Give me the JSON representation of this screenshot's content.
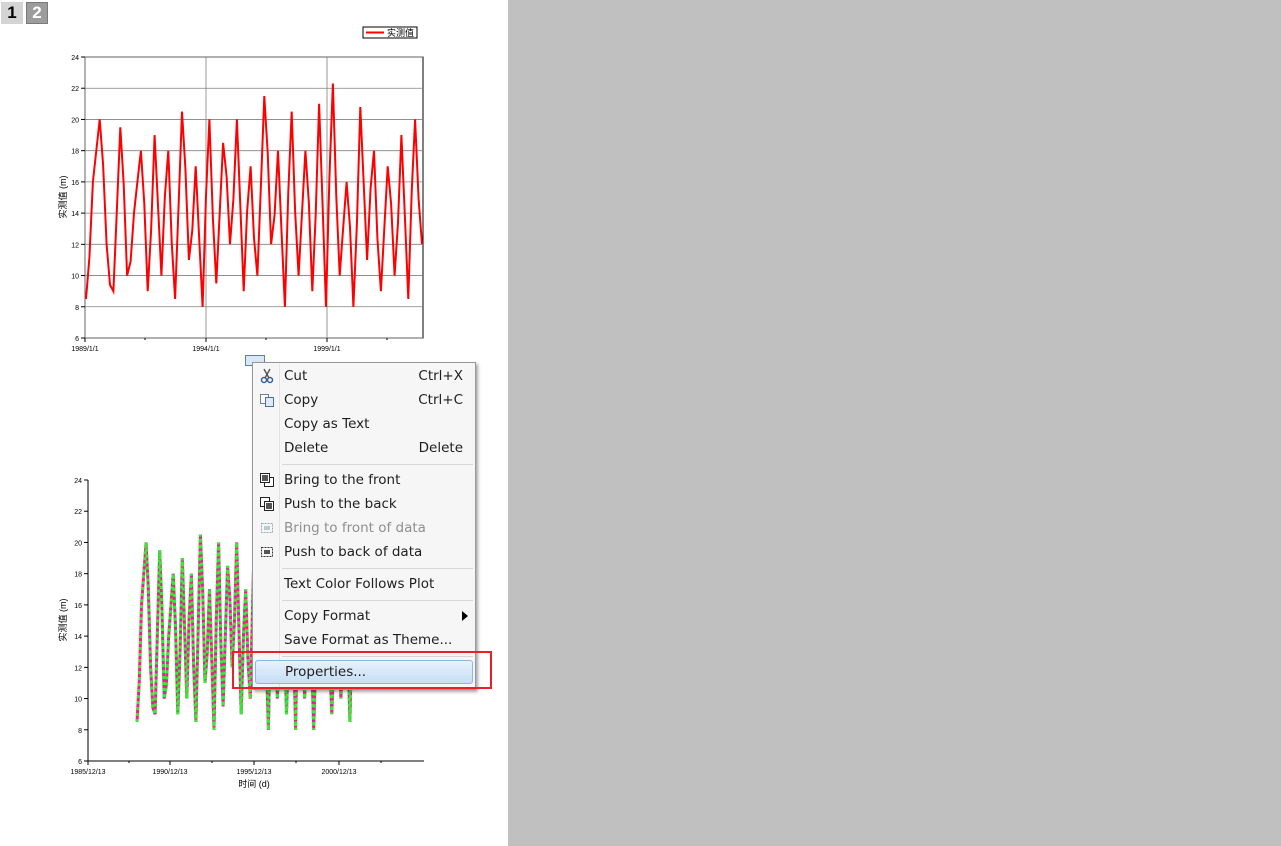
{
  "tabs": [
    {
      "label": "1"
    },
    {
      "label": "2"
    }
  ],
  "colors": {
    "series_red": "#ff0000",
    "series_magenta": "#e8208c",
    "series_green": "#30ee30",
    "highlight_box": "#e8202a",
    "background_gray": "#c0c0c0"
  },
  "chart_data": [
    {
      "type": "line",
      "legend": [
        "实测值"
      ],
      "legend_position": "top-right",
      "ylabel": "实测值 (m)",
      "xlabel": "",
      "x_ticks": [
        "1989/1/1",
        "1994/1/1",
        "1999/1/1"
      ],
      "y_ticks": [
        "6",
        "8",
        "10",
        "12",
        "14",
        "16",
        "18",
        "20",
        "22",
        "24"
      ],
      "ylim": [
        6,
        24
      ],
      "grid": true,
      "series": [
        {
          "values": [
            8.5,
            16,
            20,
            12,
            9,
            19.5,
            10,
            14,
            18,
            9,
            19,
            10,
            18,
            8.5,
            20.5,
            11,
            17,
            8,
            20,
            9.5,
            18.5,
            12,
            20,
            9,
            17,
            10,
            21.5,
            12,
            18,
            8,
            20.5,
            10,
            18,
            9,
            21,
            8,
            22.3,
            10,
            16,
            8,
            20.8,
            11,
            18,
            9,
            17,
            10,
            19,
            8.5,
            20,
            12
          ]
        }
      ]
    },
    {
      "type": "line",
      "ylabel": "实测值 (m)",
      "xlabel": "时间 (d)",
      "x_ticks": [
        "1985/12/13",
        "1990/12/13",
        "1995/12/13",
        "2000/12/13"
      ],
      "y_ticks": [
        "6",
        "8",
        "10",
        "12",
        "14",
        "16",
        "18",
        "20",
        "22",
        "24"
      ],
      "ylim": [
        6,
        24
      ],
      "grid": false,
      "series": [
        {
          "values": [
            8.5,
            16,
            20,
            12,
            9,
            19.5,
            10,
            14,
            18,
            9,
            19,
            10,
            18,
            8.5,
            20.5,
            11,
            17,
            8,
            20,
            9.5,
            18.5,
            12,
            20,
            9,
            17,
            10,
            21.5,
            12,
            18,
            8,
            20.5,
            10,
            18,
            9,
            21,
            8,
            22,
            10,
            16,
            8,
            20.5,
            11,
            18,
            9,
            17,
            10,
            19,
            8.5,
            20,
            12
          ]
        }
      ]
    }
  ],
  "context_menu": {
    "items": [
      {
        "label": "Cut",
        "shortcut": "Ctrl+X",
        "icon": "scissors-icon"
      },
      {
        "label": "Copy",
        "shortcut": "Ctrl+C",
        "icon": "copy-icon"
      },
      {
        "label": "Copy as Text",
        "shortcut": ""
      },
      {
        "label": "Delete",
        "shortcut": "Delete"
      },
      {
        "label": "Bring to the front",
        "icon": "bring-front-icon"
      },
      {
        "label": "Push to the back",
        "icon": "push-back-icon"
      },
      {
        "label": "Bring to front of data",
        "icon": "bring-front-data-icon",
        "disabled": true
      },
      {
        "label": "Push to back of data",
        "icon": "push-back-data-icon"
      },
      {
        "label": "Text Color Follows Plot"
      },
      {
        "label": "Copy Format",
        "submenu": true
      },
      {
        "label": "Save Format as Theme..."
      },
      {
        "label": "Properties..."
      }
    ]
  }
}
